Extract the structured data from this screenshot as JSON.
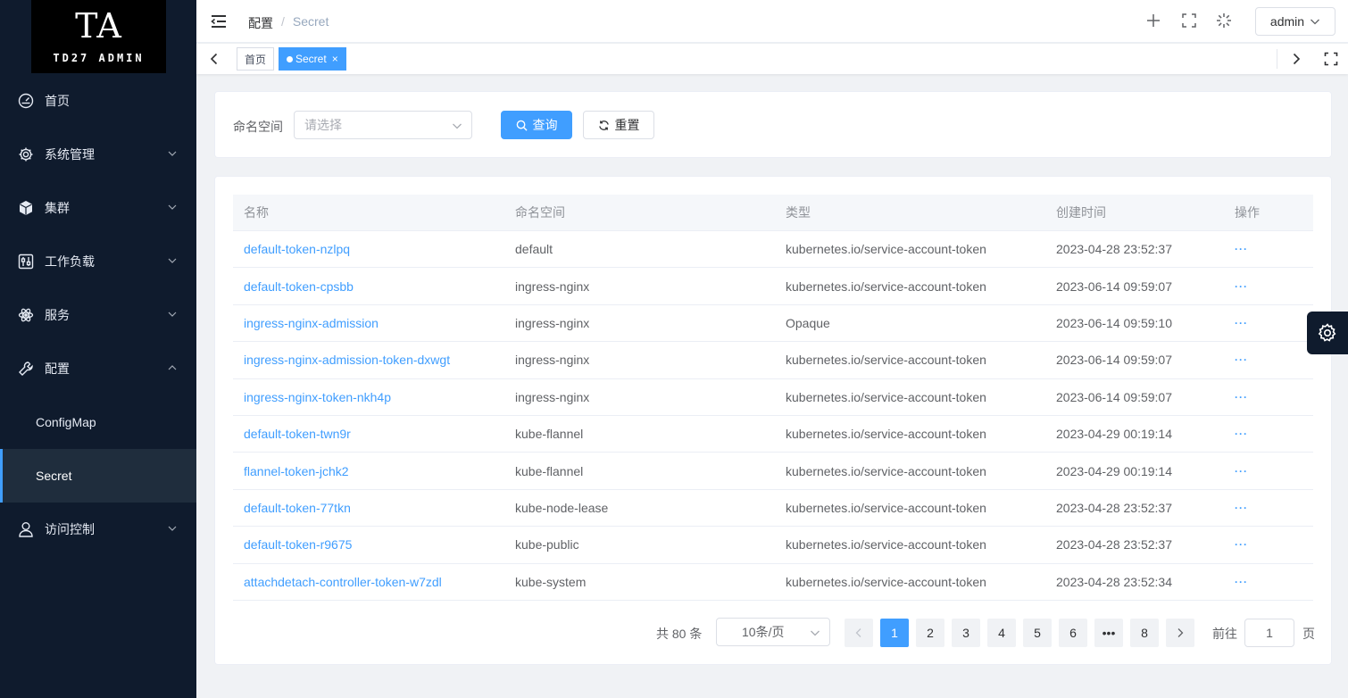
{
  "logo": {
    "title": "TA",
    "subtitle": "TD27 ADMIN"
  },
  "sidebar": {
    "items": [
      {
        "label": "首页",
        "icon": "dashboard-icon"
      },
      {
        "label": "系统管理",
        "icon": "gear-icon",
        "expandable": true
      },
      {
        "label": "集群",
        "icon": "box-icon",
        "expandable": true
      },
      {
        "label": "工作负载",
        "icon": "sliders-icon",
        "expandable": true
      },
      {
        "label": "服务",
        "icon": "atom-icon",
        "expandable": true
      },
      {
        "label": "配置",
        "icon": "wrench-icon",
        "expanded": true,
        "children": [
          {
            "label": "ConfigMap"
          },
          {
            "label": "Secret",
            "active": true
          }
        ]
      },
      {
        "label": "访问控制",
        "icon": "user-icon",
        "expandable": true
      }
    ]
  },
  "header": {
    "breadcrumb": [
      "配置",
      "Secret"
    ],
    "user": "admin"
  },
  "tabs": [
    {
      "label": "首页",
      "active": false
    },
    {
      "label": "Secret",
      "active": true
    }
  ],
  "search": {
    "namespace_label": "命名空间",
    "namespace_placeholder": "请选择",
    "query_label": "查询",
    "reset_label": "重置"
  },
  "table": {
    "columns": [
      "名称",
      "命名空间",
      "类型",
      "创建时间",
      "操作"
    ],
    "rows": [
      {
        "name": "default-token-nzlpq",
        "namespace": "default",
        "type": "kubernetes.io/service-account-token",
        "created": "2023-04-28 23:52:37",
        "ops": "···"
      },
      {
        "name": "default-token-cpsbb",
        "namespace": "ingress-nginx",
        "type": "kubernetes.io/service-account-token",
        "created": "2023-06-14 09:59:07",
        "ops": "···"
      },
      {
        "name": "ingress-nginx-admission",
        "namespace": "ingress-nginx",
        "type": "Opaque",
        "created": "2023-06-14 09:59:10",
        "ops": "···"
      },
      {
        "name": "ingress-nginx-admission-token-dxwgt",
        "namespace": "ingress-nginx",
        "type": "kubernetes.io/service-account-token",
        "created": "2023-06-14 09:59:07",
        "ops": "···"
      },
      {
        "name": "ingress-nginx-token-nkh4p",
        "namespace": "ingress-nginx",
        "type": "kubernetes.io/service-account-token",
        "created": "2023-06-14 09:59:07",
        "ops": "···"
      },
      {
        "name": "default-token-twn9r",
        "namespace": "kube-flannel",
        "type": "kubernetes.io/service-account-token",
        "created": "2023-04-29 00:19:14",
        "ops": "···"
      },
      {
        "name": "flannel-token-jchk2",
        "namespace": "kube-flannel",
        "type": "kubernetes.io/service-account-token",
        "created": "2023-04-29 00:19:14",
        "ops": "···"
      },
      {
        "name": "default-token-77tkn",
        "namespace": "kube-node-lease",
        "type": "kubernetes.io/service-account-token",
        "created": "2023-04-28 23:52:37",
        "ops": "···"
      },
      {
        "name": "default-token-r9675",
        "namespace": "kube-public",
        "type": "kubernetes.io/service-account-token",
        "created": "2023-04-28 23:52:37",
        "ops": "···"
      },
      {
        "name": "attachdetach-controller-token-w7zdl",
        "namespace": "kube-system",
        "type": "kubernetes.io/service-account-token",
        "created": "2023-04-28 23:52:34",
        "ops": "···"
      }
    ]
  },
  "pagination": {
    "total_text": "共 80 条",
    "page_size": "10条/页",
    "pages": [
      "1",
      "2",
      "3",
      "4",
      "5",
      "6",
      "•••",
      "8"
    ],
    "current": "1",
    "goto_label": "前往",
    "goto_value": "1",
    "goto_suffix": "页"
  },
  "colors": {
    "primary": "#409eff",
    "sidebar_bg": "#0f1b2d"
  }
}
